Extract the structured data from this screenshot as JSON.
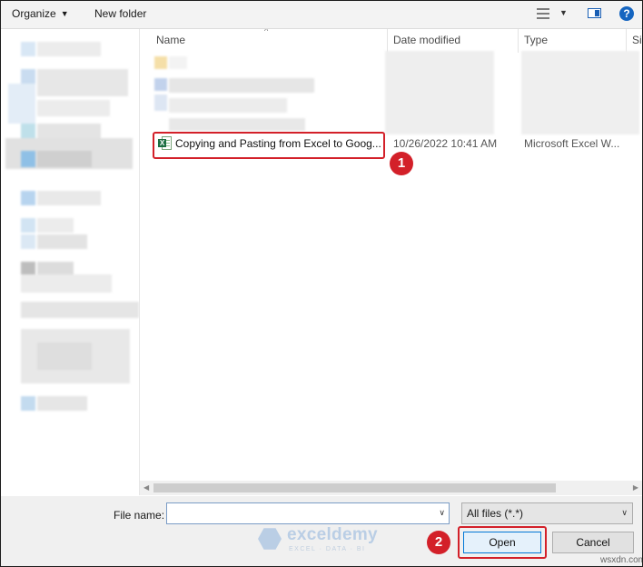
{
  "toolbar": {
    "organize_label": "Organize",
    "new_folder_label": "New folder"
  },
  "columns": {
    "name": "Name",
    "date_modified": "Date modified",
    "type": "Type",
    "size": "Si"
  },
  "file": {
    "name": "Copying and Pasting from Excel to Goog...",
    "date": "10/26/2022 10:41 AM",
    "type": "Microsoft Excel W...",
    "icon": "excel-file-icon"
  },
  "steps": {
    "step1": "1",
    "step2": "2"
  },
  "bottom": {
    "file_name_label": "File name:",
    "file_name_value": "",
    "filter_value": "All files (*.*)",
    "open_label": "Open",
    "cancel_label": "Cancel"
  },
  "watermark": {
    "name": "exceldemy",
    "tagline": "EXCEL · DATA · BI",
    "corner": "wsxdn.com"
  },
  "colors": {
    "highlight": "#d32029",
    "accent": "#0078d7",
    "help": "#1565c0",
    "excel": "#1d6f42"
  }
}
